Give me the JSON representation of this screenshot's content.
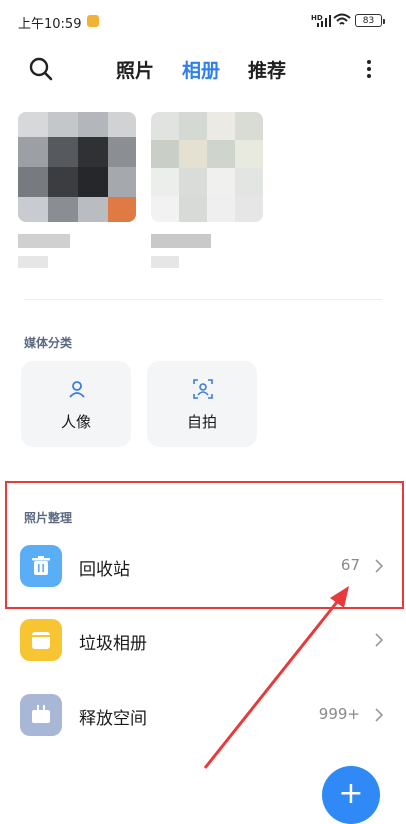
{
  "status": {
    "time": "上午10:59",
    "hd": "HD",
    "battery": "83"
  },
  "nav": {
    "tabs": [
      {
        "label": "照片"
      },
      {
        "label": "相册"
      },
      {
        "label": "推荐"
      }
    ],
    "active_tab": "相册"
  },
  "media_section": {
    "title": "媒体分类",
    "cards": [
      {
        "label": "人像",
        "icon": "person-icon"
      },
      {
        "label": "自拍",
        "icon": "selfie-icon"
      }
    ]
  },
  "organize_section": {
    "title": "照片整理",
    "items": [
      {
        "label": "回收站",
        "count": "67",
        "icon": "trash-icon",
        "color": "#5aaef5"
      },
      {
        "label": "垃圾相册",
        "count": "",
        "icon": "folder-icon",
        "color": "#f6c531"
      },
      {
        "label": "释放空间",
        "count": "999+",
        "icon": "cleanup-icon",
        "color": "#a9b7d6"
      }
    ]
  },
  "fab": {
    "label": "+"
  },
  "colors": {
    "accent": "#2f80ed",
    "highlight": "#e83a3a"
  }
}
